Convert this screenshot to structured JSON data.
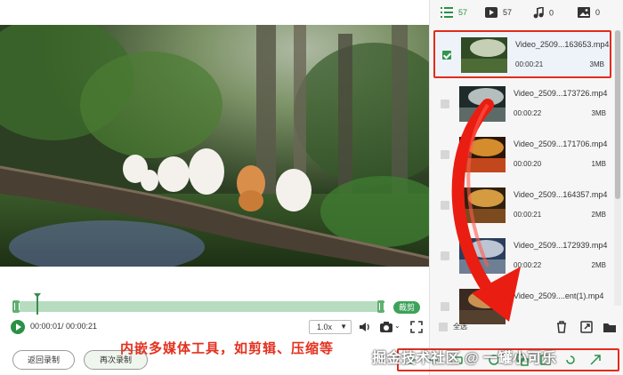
{
  "filters": {
    "all_count": "57",
    "video_count": "57",
    "audio_count": "0",
    "image_count": "0"
  },
  "player": {
    "timecode": "00:00:01/ 00:00:21",
    "speed": "1.0x",
    "trim_label": "裁剪"
  },
  "actions": {
    "back_label": "返回录制",
    "again_label": "再次录制"
  },
  "caption": "内嵌多媒体工具，如剪辑、压缩等",
  "watermark": "掘金技术社区 @ 一罐小可乐",
  "files": [
    {
      "name": "Video_2509...163653.mp4",
      "duration": "00:00:21",
      "size": "3MB",
      "selected": true,
      "thumb": "forest"
    },
    {
      "name": "Video_2509...173726.mp4",
      "duration": "00:00:22",
      "size": "3MB",
      "selected": false,
      "thumb": "waterfall"
    },
    {
      "name": "Video_2509...171706.mp4",
      "duration": "00:00:20",
      "size": "1MB",
      "selected": false,
      "thumb": "fire"
    },
    {
      "name": "Video_2509...164357.mp4",
      "duration": "00:00:21",
      "size": "2MB",
      "selected": false,
      "thumb": "sunset"
    },
    {
      "name": "Video_2509...172939.mp4",
      "duration": "00:00:22",
      "size": "2MB",
      "selected": false,
      "thumb": "mountain"
    },
    {
      "name": "Video_2509....ent(1).mp4",
      "duration": "",
      "size": "",
      "selected": false,
      "thumb": "dusk"
    }
  ],
  "select_all_label": "全选",
  "colors": {
    "accent_green": "#2a9145",
    "highlight_red": "#e32b1c"
  }
}
